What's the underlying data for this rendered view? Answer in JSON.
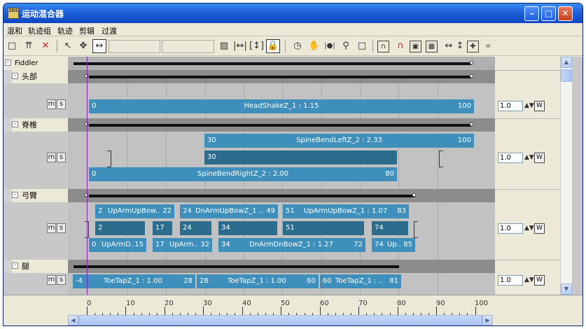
{
  "window": {
    "title": "运动混合器"
  },
  "menu": [
    "混和",
    "轨迹组",
    "轨迹",
    "剪辑",
    "过渡"
  ],
  "groups": {
    "root": "Fiddler Bipe",
    "head": "头部",
    "spine": "脊椎",
    "arm": "弓臂",
    "leg": "腿"
  },
  "ms": {
    "m": "m",
    "s": "s"
  },
  "weights": {
    "head": "1.0",
    "spine": "1.0",
    "arm": "1.0",
    "leg": "1.0"
  },
  "wbtn": "W",
  "toolbar_extra": "w",
  "clips": {
    "head": {
      "name": "HeadShakeZ_1 : 1.15",
      "start": "0",
      "end": "100"
    },
    "spine1": {
      "name": "SpineBendLeftZ_2 : 2.33",
      "start": "30",
      "end": "100"
    },
    "spine2": {
      "start": "30"
    },
    "spine3": {
      "name": "SpineBendRightZ_2 : 2.00",
      "start": "0",
      "end": "80"
    },
    "arm1a": {
      "name": "UpArmUpBow..",
      "start": "2",
      "end": "22"
    },
    "arm1b": {
      "name": "DnArmUpBowZ_1 ..",
      "start": "24",
      "end": "49"
    },
    "arm1c": {
      "name": "UpArmUpBowZ_1 : 1.07",
      "start": "51",
      "end": "83"
    },
    "arm2a": {
      "start": "2"
    },
    "arm2b": {
      "start": "17"
    },
    "arm2c": {
      "start": "24"
    },
    "arm2d": {
      "start": "34"
    },
    "arm2e": {
      "start": "51"
    },
    "arm2f": {
      "start": "74"
    },
    "arm3a": {
      "name": "UpArmD..",
      "start": "0",
      "end": "15"
    },
    "arm3b": {
      "name": "UpArm..",
      "start": "17",
      "end": "32"
    },
    "arm3c": {
      "name": "DnArmDnBowZ_1 : 1.27",
      "start": "34",
      "end": "72"
    },
    "arm3d": {
      "name": "Up..",
      "start": "74",
      "end": "85"
    },
    "leg1": {
      "name": "ToeTapZ_1 : 1.00",
      "start": "-4",
      "end": "28"
    },
    "leg2": {
      "name": "ToeTapZ_1 : 1.00",
      "start": "28",
      "end": "60"
    },
    "leg3": {
      "name": "ToeTapZ_1 : ..",
      "start": "60",
      "end": "81"
    }
  },
  "ruler": [
    "0",
    "10",
    "20",
    "30",
    "40",
    "50",
    "60",
    "70",
    "80",
    "90",
    "100"
  ]
}
